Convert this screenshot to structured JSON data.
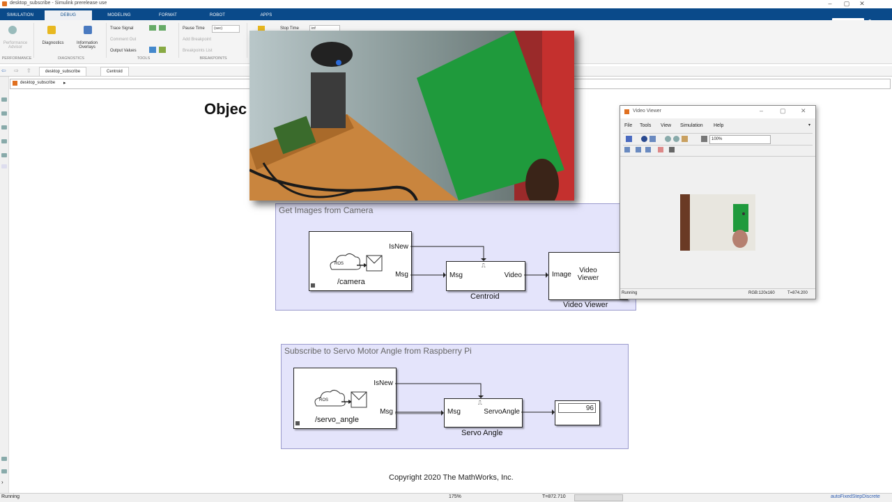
{
  "window": {
    "title": "desktop_subscribe - Simulink prerelease use"
  },
  "ribbon_tabs": [
    "SIMULATION",
    "DEBUG",
    "MODELING",
    "FORMAT",
    "ROBOT",
    "APPS"
  ],
  "active_tab": "DEBUG",
  "toolstrip": {
    "performance_advisor": "Performance Advisor",
    "diagnostics": "Diagnostics",
    "information_overlays": "Information Overlays",
    "trace_signal": "Trace Signal",
    "comment_out": "Comment Out",
    "output_values": "Output Values",
    "pause_time_label": "Pause Time",
    "pause_time_value": "(sec)",
    "add_breakpoint": "Add Breakpoint",
    "breakpoints_list": "Breakpoints List",
    "stop_time_label": "Stop Time",
    "stop_time_value": "inf",
    "groups": [
      "PERFORMANCE",
      "DIAGNOSTICS",
      "TOOLS",
      "BREAKPOINTS"
    ]
  },
  "model_tabs": [
    "desktop_subscribe",
    "Centroid"
  ],
  "breadcrumb": "desktop_subscribe",
  "model_title": "Objec                                                     n Ras   Pi",
  "camera_area": {
    "title": "Get Images from Camera",
    "ros_block": {
      "topic": "/camera",
      "ports_out": [
        "IsNew",
        "Msg"
      ],
      "ros_text": "ROS"
    },
    "centroid_block": {
      "name": "Centroid",
      "port_in": "Msg",
      "port_out": "Video"
    },
    "viewer_block": {
      "name": "Video Viewer",
      "port_in": "Image",
      "text": "Video Viewer"
    }
  },
  "servo_area": {
    "title": "Subscribe to Servo Motor Angle from Raspberry Pi",
    "ros_block": {
      "topic": "/servo_angle",
      "ports_out": [
        "IsNew",
        "Msg"
      ],
      "ros_text": "ROS"
    },
    "servo_block": {
      "name": "Servo Angle",
      "port_in": "Msg",
      "port_out": "ServoAngle"
    },
    "display_value": "96"
  },
  "copyright": "Copyright 2020 The MathWorks, Inc.",
  "video_viewer": {
    "title": "Video Viewer",
    "menu": [
      "File",
      "Tools",
      "View",
      "Simulation",
      "Help"
    ],
    "zoom": "100%",
    "status_left": "Running",
    "status_mid": "RGB:120x160",
    "status_right": "T=874.200"
  },
  "statusbar": {
    "left": "Running",
    "zoom": "175%",
    "time": "T=872.710",
    "solver": "autoFixedStepDiscrete"
  },
  "colors": {
    "ribbon_blue": "#0a4a8a",
    "area_fill": "#e4e4fb",
    "green_paper": "#1f9a3c"
  }
}
